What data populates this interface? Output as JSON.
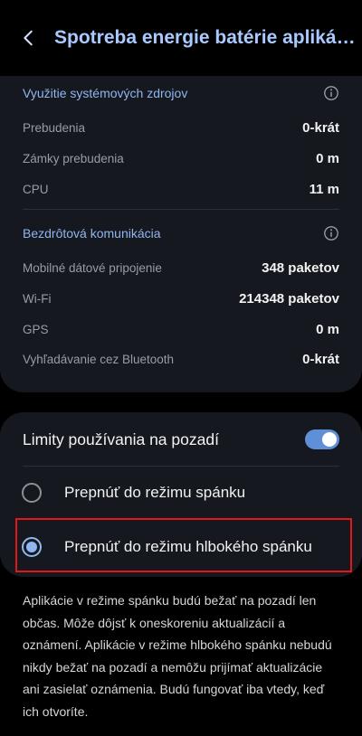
{
  "header": {
    "title": "Spotreba energie batérie aplikácie"
  },
  "system_resources": {
    "title": "Využitie systémových zdrojov",
    "rows": [
      {
        "label": "Prebudenia",
        "value": "0-krát"
      },
      {
        "label": "Zámky prebudenia",
        "value": "0 m"
      },
      {
        "label": "CPU",
        "value": "11 m"
      }
    ]
  },
  "wireless": {
    "title": "Bezdrôtová komunikácia",
    "rows": [
      {
        "label": "Mobilné dátové pripojenie",
        "value": "348 paketov"
      },
      {
        "label": "Wi-Fi",
        "value": "214348 paketov"
      },
      {
        "label": "GPS",
        "value": "0 m"
      },
      {
        "label": "Vyhľadávanie cez Bluetooth",
        "value": "0-krát"
      }
    ]
  },
  "background_limits": {
    "label": "Limity používania na pozadí",
    "enabled": true,
    "options": [
      {
        "label": "Prepnúť do režimu spánku",
        "selected": false
      },
      {
        "label": "Prepnúť do režimu hlbokého spánku",
        "selected": true
      }
    ]
  },
  "description": "Aplikácie v režime spánku budú bežať na pozadí len občas. Môže dôjsť k oneskoreniu aktualizácií a oznámení. Aplikácie v režime hlbokého spánku nebudú nikdy bežať na pozadí a nemôžu prijímať aktualizácie ani zasielať oznámenia. Budú fungovať iba vtedy, keď ich otvoríte.",
  "colors": {
    "accent": "#8fb6f0",
    "title": "#a9c9ff",
    "card": "#16181f",
    "highlight": "#e01818"
  }
}
